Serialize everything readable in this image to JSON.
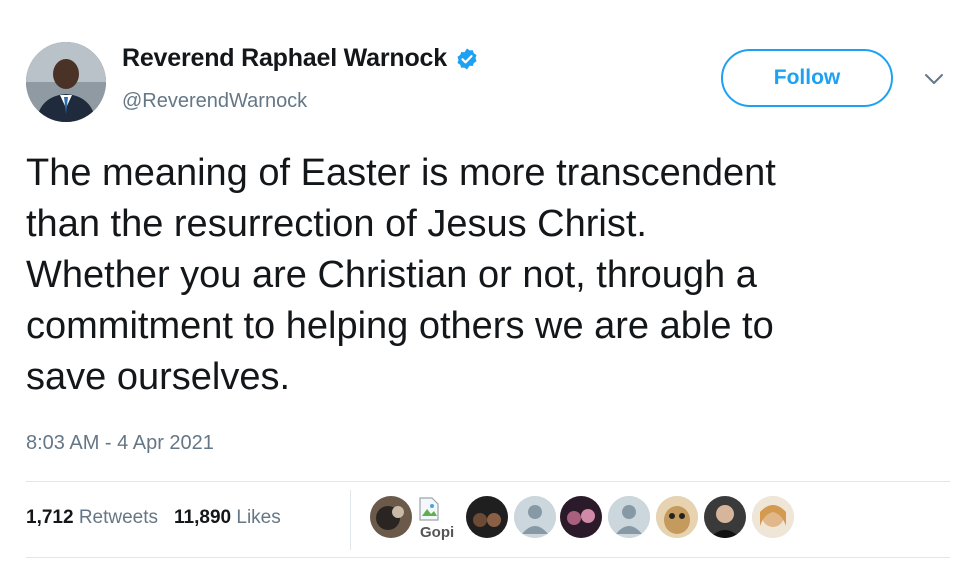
{
  "author": {
    "name": "Reverend Raphael Warnock",
    "handle": "@ReverendWarnock",
    "verified": true
  },
  "follow_label": "Follow",
  "tweet_text": "The meaning of Easter is more transcendent\nthan the resurrection of Jesus Christ.\nWhether you are Christian or not, through a\ncommitment to helping others we are able to\nsave ourselves.",
  "timestamp": "8:03 AM - 4 Apr 2021",
  "stats": {
    "retweets_count": "1,712",
    "retweets_label": "Retweets",
    "likes_count": "11,890",
    "likes_label": "Likes"
  },
  "likers": {
    "broken_image_alt": "Gopi"
  },
  "colors": {
    "accent": "#1da1f2",
    "text": "#14171a",
    "muted": "#657786",
    "divider": "#e1e8ed"
  }
}
